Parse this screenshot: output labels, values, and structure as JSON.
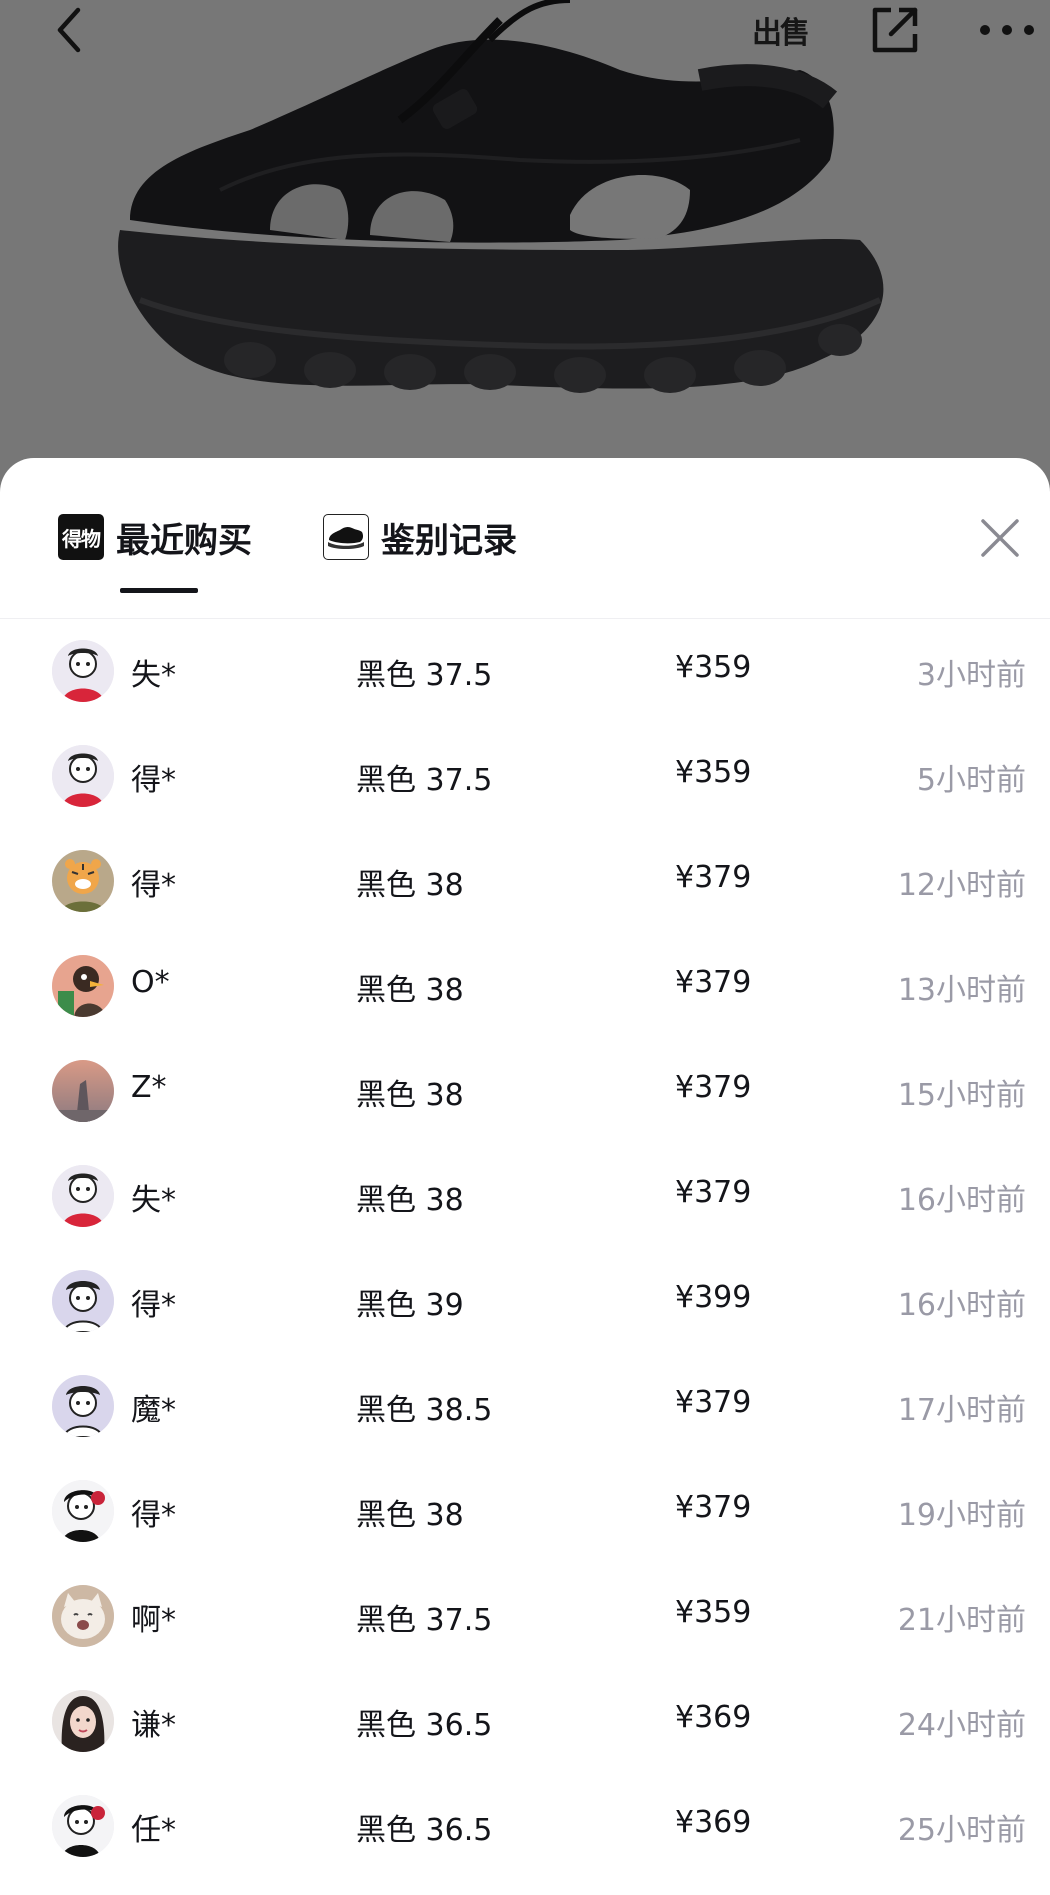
{
  "header": {
    "back_icon": "chevron-left-icon",
    "sell_label": "出售",
    "share_icon": "share-external-icon",
    "more_icon": "more-dots-icon"
  },
  "tabs": [
    {
      "label": "最近购买",
      "logo_text": "得物",
      "active": true
    },
    {
      "label": "鉴别记录",
      "icon": "shoe-thumbnail-icon",
      "active": false
    }
  ],
  "close_icon": "close-icon",
  "colors": {
    "hero_bg": "#777777",
    "text_primary": "#14151a",
    "text_secondary": "#9a9aa6",
    "tab_underline": "#14151a"
  },
  "purchases": [
    {
      "name": "失*",
      "spec": "黑色 37.5",
      "price": "¥359",
      "time": "3小时前",
      "avatar": "cartoon-red-avatar"
    },
    {
      "name": "得*",
      "spec": "黑色 37.5",
      "price": "¥359",
      "time": "5小时前",
      "avatar": "cartoon-red-avatar"
    },
    {
      "name": "得*",
      "spec": "黑色 38",
      "price": "¥379",
      "time": "12小时前",
      "avatar": "tiger-avatar"
    },
    {
      "name": "O*",
      "spec": "黑色 38",
      "price": "¥379",
      "time": "13小时前",
      "avatar": "duck-avatar"
    },
    {
      "name": "Z*",
      "spec": "黑色 38",
      "price": "¥379",
      "time": "15小时前",
      "avatar": "sunset-photo-avatar"
    },
    {
      "name": "失*",
      "spec": "黑色 38",
      "price": "¥379",
      "time": "16小时前",
      "avatar": "cartoon-red-avatar"
    },
    {
      "name": "得*",
      "spec": "黑色 39",
      "price": "¥399",
      "time": "16小时前",
      "avatar": "cartoon-lavender-avatar"
    },
    {
      "name": "魔*",
      "spec": "黑色 38.5",
      "price": "¥379",
      "time": "17小时前",
      "avatar": "cartoon-lavender-avatar"
    },
    {
      "name": "得*",
      "spec": "黑色 38",
      "price": "¥379",
      "time": "19小时前",
      "avatar": "cartoon-bw-avatar"
    },
    {
      "name": "啊*",
      "spec": "黑色 37.5",
      "price": "¥359",
      "time": "21小时前",
      "avatar": "cat-photo-avatar"
    },
    {
      "name": "谦*",
      "spec": "黑色 36.5",
      "price": "¥369",
      "time": "24小时前",
      "avatar": "girl-photo-avatar"
    },
    {
      "name": "任*",
      "spec": "黑色 36.5",
      "price": "¥369",
      "time": "25小时前",
      "avatar": "cartoon-bw-avatar"
    }
  ]
}
